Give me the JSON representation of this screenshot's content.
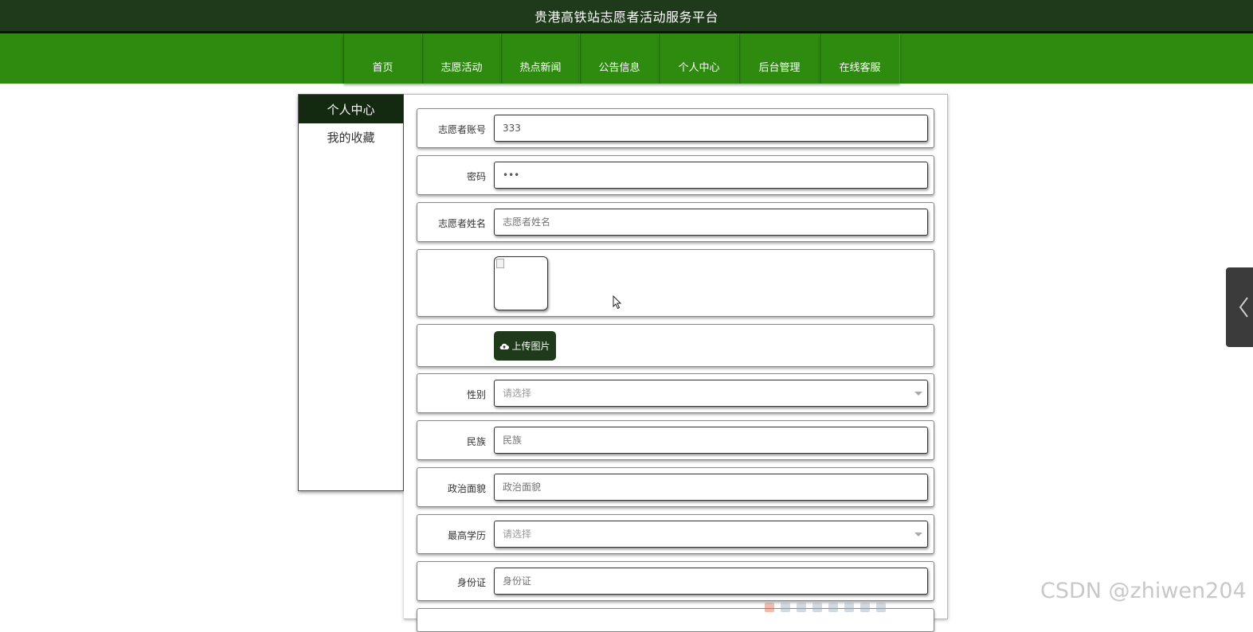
{
  "site": {
    "title": "贵港高铁站志愿者活动服务平台"
  },
  "nav": [
    {
      "label": "首页"
    },
    {
      "label": "志愿活动"
    },
    {
      "label": "热点新闻"
    },
    {
      "label": "公告信息"
    },
    {
      "label": "个人中心"
    },
    {
      "label": "后台管理"
    },
    {
      "label": "在线客服"
    }
  ],
  "sidebar": {
    "header": "个人中心",
    "items": [
      {
        "label": "我的收藏"
      }
    ]
  },
  "form": {
    "account_label": "志愿者账号",
    "account_value": "333",
    "password_label": "密码",
    "password_value": "•••",
    "name_label": "志愿者姓名",
    "name_placeholder": "志愿者姓名",
    "upload_label": "上传图片",
    "gender_label": "性别",
    "gender_placeholder": "请选择",
    "ethnicity_label": "民族",
    "ethnicity_placeholder": "民族",
    "political_label": "政治面貌",
    "political_placeholder": "政治面貌",
    "education_label": "最高学历",
    "education_placeholder": "请选择",
    "idcard_label": "身份证",
    "idcard_placeholder": "身份证"
  },
  "watermark": "CSDN @zhiwen204",
  "colors": {
    "header_bg": "#1e3a1a",
    "nav_bg": "#2e8b10",
    "sidebar_active": "#132a10"
  }
}
